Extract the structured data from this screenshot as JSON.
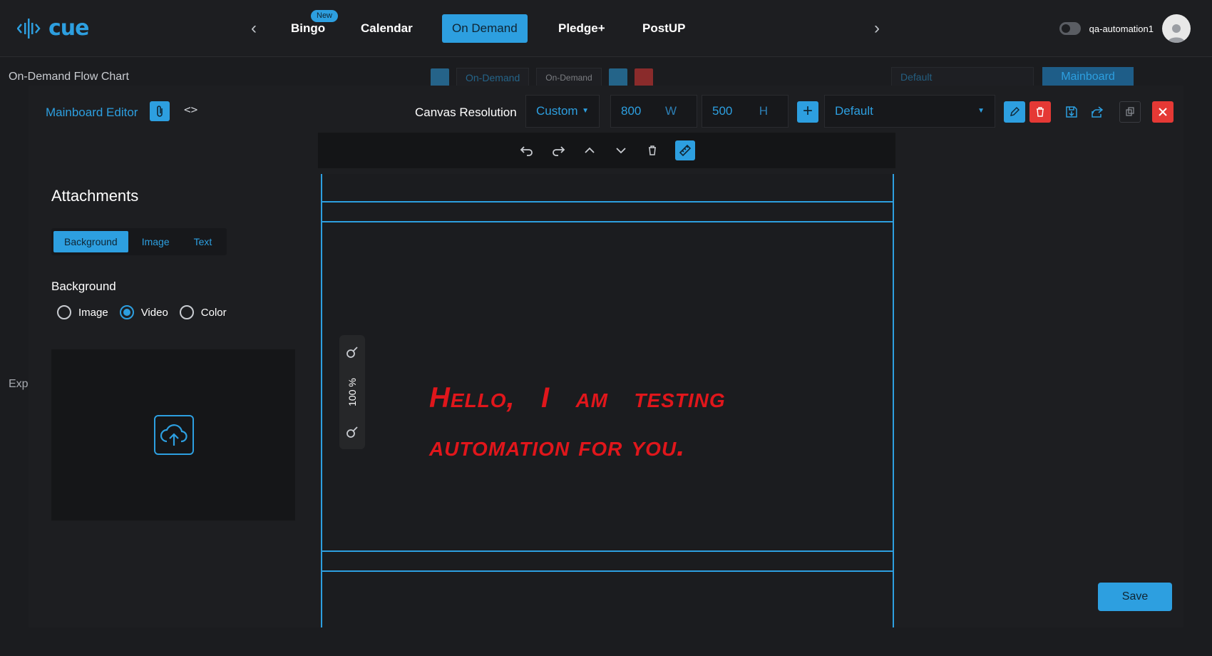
{
  "brand": {
    "logo_text": "cue"
  },
  "nav": {
    "items": [
      {
        "label": "Bingo",
        "badge": "New"
      },
      {
        "label": "Calendar"
      },
      {
        "label": "On Demand",
        "active": true
      },
      {
        "label": "Pledge+"
      },
      {
        "label": "PostUP"
      }
    ]
  },
  "user": {
    "name": "qa-automation1"
  },
  "background_page": {
    "title": "On-Demand Flow Chart",
    "select_1": "On-Demand",
    "select_2": "On-Demand",
    "preset": "Default",
    "mainboard": "Mainboard",
    "exp_label": "Exp"
  },
  "modal": {
    "title": "Mainboard Editor",
    "canvas_resolution_label": "Canvas Resolution",
    "resolution_mode": "Custom",
    "width_value": "800",
    "width_unit": "W",
    "height_value": "500",
    "height_unit": "H",
    "preset": "Default",
    "attachments": {
      "title": "Attachments",
      "tabs": [
        "Background",
        "Image",
        "Text"
      ],
      "active_tab": "Background",
      "background_label": "Background",
      "radio_options": [
        "Image",
        "Video",
        "Color"
      ],
      "selected_option": "Video"
    },
    "canvas": {
      "text_line_1": "Hello,   I   am   testing",
      "text_line_2": "automation for you.",
      "text_color": "#e0161b",
      "zoom": "100 %"
    },
    "save_label": "Save"
  },
  "colors": {
    "accent": "#2d9fe0",
    "danger": "#e53935",
    "background": "#1b1c1f"
  }
}
